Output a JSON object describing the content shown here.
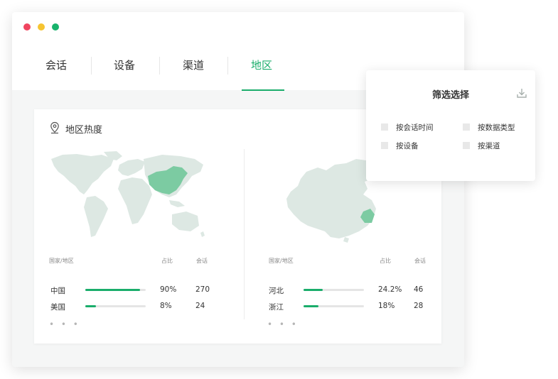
{
  "tabs": [
    {
      "label": "会话",
      "active": false
    },
    {
      "label": "设备",
      "active": false
    },
    {
      "label": "渠道",
      "active": false
    },
    {
      "label": "地区",
      "active": true
    }
  ],
  "card": {
    "title": "地区热度"
  },
  "left_table": {
    "headers": [
      "国家/地区",
      "占比",
      "会话"
    ],
    "rows": [
      {
        "name": "中国",
        "ratio": "90%",
        "ratio_value": 0.9,
        "count": "270"
      },
      {
        "name": "美国",
        "ratio": "8%",
        "ratio_value": 0.18,
        "count": "24"
      }
    ],
    "more": "• • •"
  },
  "right_table": {
    "headers": [
      "国家/地区",
      "占比",
      "会话"
    ],
    "rows": [
      {
        "name": "河北",
        "ratio": "24.2%",
        "ratio_value": 0.32,
        "count": "46"
      },
      {
        "name": "浙江",
        "ratio": "18%",
        "ratio_value": 0.25,
        "count": "28"
      }
    ],
    "more": "• • •"
  },
  "filter_popup": {
    "title": "筛选选择",
    "options": [
      "按会话时间",
      "按数据类型",
      "按设备",
      "按渠道"
    ]
  },
  "colors": {
    "accent": "#1aad6b",
    "map_land": "#dde8e3",
    "map_highlight": "#7ccba2"
  },
  "icons": {
    "location": "location-pin-icon",
    "download": "download-icon"
  }
}
